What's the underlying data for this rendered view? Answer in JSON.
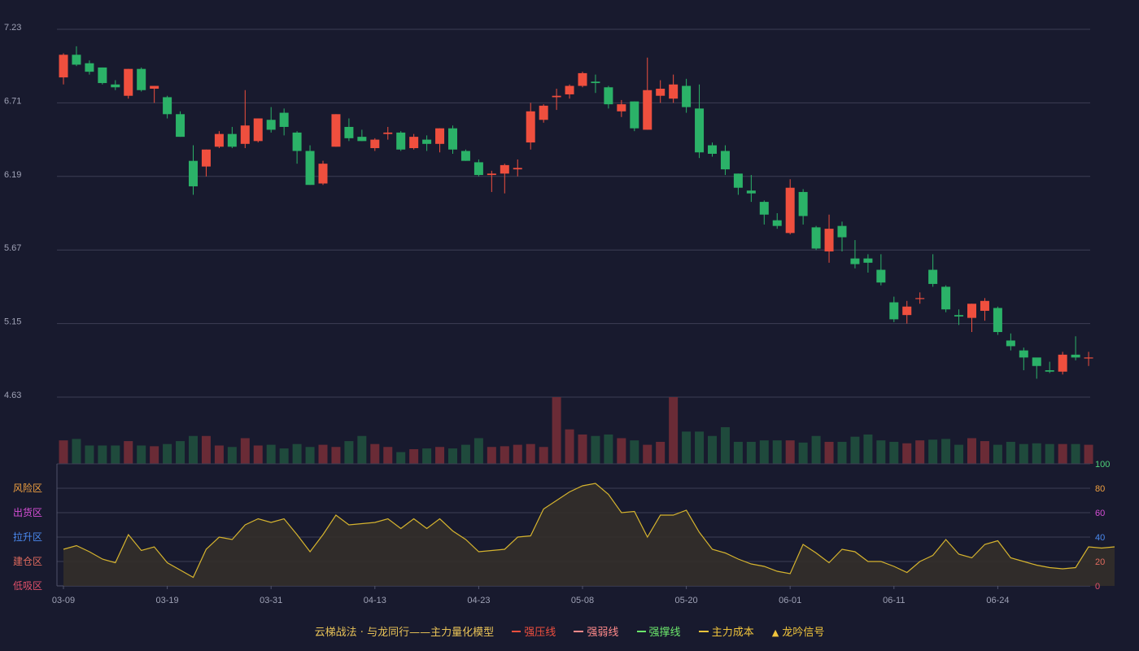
{
  "chart_data": {
    "type": "candlestick",
    "price_axis": {
      "ticks": [
        "7.23",
        "6.71",
        "6.19",
        "5.67",
        "5.15",
        "4.63"
      ],
      "min": 4.63,
      "max": 7.23
    },
    "x_tick_labels": [
      {
        "index": 0,
        "label": "03-09"
      },
      {
        "index": 8,
        "label": "03-19"
      },
      {
        "index": 16,
        "label": "03-31"
      },
      {
        "index": 24,
        "label": "04-13"
      },
      {
        "index": 32,
        "label": "04-23"
      },
      {
        "index": 40,
        "label": "05-08"
      },
      {
        "index": 48,
        "label": "05-20"
      },
      {
        "index": 56,
        "label": "06-01"
      },
      {
        "index": 64,
        "label": "06-11"
      },
      {
        "index": 72,
        "label": "06-24"
      }
    ],
    "ohlc": [
      [
        6.89,
        7.05,
        6.84,
        7.06
      ],
      [
        7.05,
        6.98,
        6.97,
        7.11
      ],
      [
        6.99,
        6.93,
        6.91,
        7.01
      ],
      [
        6.96,
        6.85,
        6.84,
        6.96
      ],
      [
        6.84,
        6.82,
        6.8,
        6.87
      ],
      [
        6.76,
        6.95,
        6.74,
        6.95
      ],
      [
        6.95,
        6.8,
        6.79,
        6.96
      ],
      [
        6.81,
        6.83,
        6.71,
        6.83
      ],
      [
        6.75,
        6.63,
        6.6,
        6.76
      ],
      [
        6.63,
        6.47,
        6.47,
        6.65
      ],
      [
        6.3,
        6.12,
        6.06,
        6.41
      ],
      [
        6.26,
        6.38,
        6.19,
        6.38
      ],
      [
        6.4,
        6.49,
        6.39,
        6.51
      ],
      [
        6.49,
        6.4,
        6.39,
        6.54
      ],
      [
        6.42,
        6.55,
        6.39,
        6.8
      ],
      [
        6.44,
        6.6,
        6.43,
        6.6
      ],
      [
        6.59,
        6.52,
        6.5,
        6.68
      ],
      [
        6.64,
        6.54,
        6.48,
        6.67
      ],
      [
        6.5,
        6.37,
        6.28,
        6.51
      ],
      [
        6.37,
        6.13,
        6.13,
        6.41
      ],
      [
        6.14,
        6.28,
        6.13,
        6.3
      ],
      [
        6.4,
        6.63,
        6.4,
        6.63
      ],
      [
        6.54,
        6.46,
        6.44,
        6.6
      ],
      [
        6.47,
        6.44,
        6.44,
        6.52
      ],
      [
        6.39,
        6.45,
        6.37,
        6.46
      ],
      [
        6.49,
        6.5,
        6.45,
        6.54
      ],
      [
        6.5,
        6.38,
        6.37,
        6.51
      ],
      [
        6.39,
        6.47,
        6.38,
        6.49
      ],
      [
        6.45,
        6.42,
        6.37,
        6.48
      ],
      [
        6.42,
        6.53,
        6.36,
        6.53
      ],
      [
        6.53,
        6.38,
        6.35,
        6.55
      ],
      [
        6.37,
        6.3,
        6.3,
        6.38
      ],
      [
        6.29,
        6.2,
        6.19,
        6.31
      ],
      [
        6.2,
        6.21,
        6.08,
        6.23
      ],
      [
        6.21,
        6.27,
        6.07,
        6.28
      ],
      [
        6.24,
        6.25,
        6.19,
        6.31
      ],
      [
        6.43,
        6.65,
        6.38,
        6.71
      ],
      [
        6.59,
        6.69,
        6.57,
        6.7
      ],
      [
        6.75,
        6.76,
        6.66,
        6.81
      ],
      [
        6.77,
        6.83,
        6.74,
        6.84
      ],
      [
        6.83,
        6.92,
        6.82,
        6.93
      ],
      [
        6.86,
        6.85,
        6.78,
        6.91
      ],
      [
        6.82,
        6.7,
        6.67,
        6.83
      ],
      [
        6.65,
        6.7,
        6.61,
        6.73
      ],
      [
        6.72,
        6.53,
        6.51,
        6.72
      ],
      [
        6.52,
        6.8,
        6.52,
        7.03
      ],
      [
        6.76,
        6.81,
        6.71,
        6.87
      ],
      [
        6.74,
        6.84,
        6.71,
        6.91
      ],
      [
        6.83,
        6.68,
        6.64,
        6.88
      ],
      [
        6.67,
        6.36,
        6.32,
        6.84
      ],
      [
        6.41,
        6.35,
        6.33,
        6.43
      ],
      [
        6.37,
        6.24,
        6.2,
        6.41
      ],
      [
        6.21,
        6.11,
        6.06,
        6.21
      ],
      [
        6.09,
        6.07,
        6.01,
        6.2
      ],
      [
        6.01,
        5.92,
        5.85,
        6.02
      ],
      [
        5.88,
        5.84,
        5.82,
        5.93
      ],
      [
        5.79,
        6.11,
        5.78,
        6.17
      ],
      [
        6.08,
        5.91,
        5.85,
        6.1
      ],
      [
        5.83,
        5.68,
        5.67,
        5.84
      ],
      [
        5.66,
        5.82,
        5.58,
        5.92
      ],
      [
        5.84,
        5.76,
        5.66,
        5.87
      ],
      [
        5.61,
        5.57,
        5.54,
        5.74
      ],
      [
        5.61,
        5.58,
        5.51,
        5.64
      ],
      [
        5.53,
        5.44,
        5.42,
        5.64
      ],
      [
        5.3,
        5.18,
        5.16,
        5.34
      ],
      [
        5.21,
        5.27,
        5.15,
        5.31
      ],
      [
        5.33,
        5.33,
        5.29,
        5.37
      ],
      [
        5.53,
        5.43,
        5.41,
        5.64
      ],
      [
        5.41,
        5.25,
        5.23,
        5.42
      ],
      [
        5.21,
        5.2,
        5.14,
        5.25
      ],
      [
        5.19,
        5.29,
        5.09,
        5.29
      ],
      [
        5.24,
        5.31,
        5.17,
        5.33
      ],
      [
        5.26,
        5.09,
        5.07,
        5.27
      ],
      [
        5.03,
        4.99,
        4.96,
        5.08
      ],
      [
        4.96,
        4.91,
        4.82,
        4.98
      ],
      [
        4.91,
        4.85,
        4.76,
        4.89
      ],
      [
        4.82,
        4.81,
        4.8,
        4.88
      ],
      [
        4.81,
        4.93,
        4.79,
        4.95
      ],
      [
        4.93,
        4.91,
        4.89,
        5.06
      ],
      [
        4.91,
        4.91,
        4.85,
        4.95
      ]
    ],
    "volume": [
      32,
      34,
      25,
      25,
      25,
      31,
      25,
      24,
      27,
      31,
      38,
      38,
      25,
      23,
      35,
      25,
      26,
      21,
      27,
      23,
      26,
      23,
      31,
      38,
      27,
      23,
      16,
      20,
      21,
      23,
      21,
      26,
      35,
      23,
      24,
      26,
      27,
      23,
      91,
      47,
      40,
      38,
      40,
      35,
      32,
      26,
      30,
      91,
      44,
      44,
      38,
      50,
      30,
      30,
      32,
      32,
      32,
      29,
      38,
      30,
      30,
      37,
      40,
      32,
      30,
      28,
      32,
      33,
      34,
      26,
      35,
      31,
      26,
      30,
      27,
      28,
      27,
      27,
      27,
      26,
      28,
      27,
      24
    ],
    "oscillator": {
      "zones": [
        "风险区",
        "出货区",
        "拉升区",
        "建仓区",
        "低吸区"
      ],
      "axis_ticks": [
        "100",
        "80",
        "60",
        "40",
        "20",
        "0"
      ],
      "values": [
        30,
        33,
        28,
        22,
        19,
        42,
        29,
        32,
        19,
        13,
        7,
        30,
        40,
        38,
        50,
        55,
        52,
        55,
        42,
        28,
        42,
        58,
        50,
        51,
        52,
        55,
        47,
        55,
        47,
        55,
        45,
        38,
        28,
        29,
        30,
        40,
        41,
        63,
        70,
        77,
        82,
        84,
        75,
        60,
        61,
        40,
        58,
        58,
        62,
        44,
        30,
        27,
        22,
        18,
        16,
        12,
        10,
        34,
        27,
        19,
        30,
        28,
        20,
        20,
        16,
        11,
        20,
        25,
        38,
        26,
        23,
        34,
        37,
        23,
        20,
        17,
        15,
        14,
        15,
        32,
        31,
        32
      ]
    },
    "legend": [
      {
        "label": "云梯战法 · 与龙同行——主力量化模型",
        "style": "text"
      },
      {
        "label": "强压线",
        "style": "line",
        "color": "#ef4f3e"
      },
      {
        "label": "强弱线",
        "style": "dash",
        "color": "#ff8a8a"
      },
      {
        "label": "强撑线",
        "style": "line",
        "color": "#6be66b"
      },
      {
        "label": "主力成本",
        "style": "dash",
        "color": "#f0c43c"
      },
      {
        "label": "龙吟信号",
        "style": "triangle",
        "color": "#f0c43c"
      }
    ]
  },
  "colors": {
    "background": "#181a2e",
    "up": "#ef4f3e",
    "down": "#2bb268",
    "vol_up": "#6a2b36",
    "vol_down": "#1f4a3c",
    "grid": "#3c3e54",
    "axis_text": "#9fa2b6",
    "osc_line": "#d6b42e",
    "osc_fill": "#332f2a",
    "zone_risk": "#f0a040",
    "zone_sell": "#d64fd6",
    "zone_pump": "#4a8af0",
    "zone_build": "#e06b5e",
    "zone_low": "#e0506a",
    "osc_axis_100": "#4fd27a",
    "osc_axis_80": "#f0a040",
    "osc_axis_60": "#d64fd6",
    "osc_axis_40": "#4a8af0",
    "osc_axis_20": "#e06b5e",
    "osc_axis_0": "#e0506a"
  }
}
